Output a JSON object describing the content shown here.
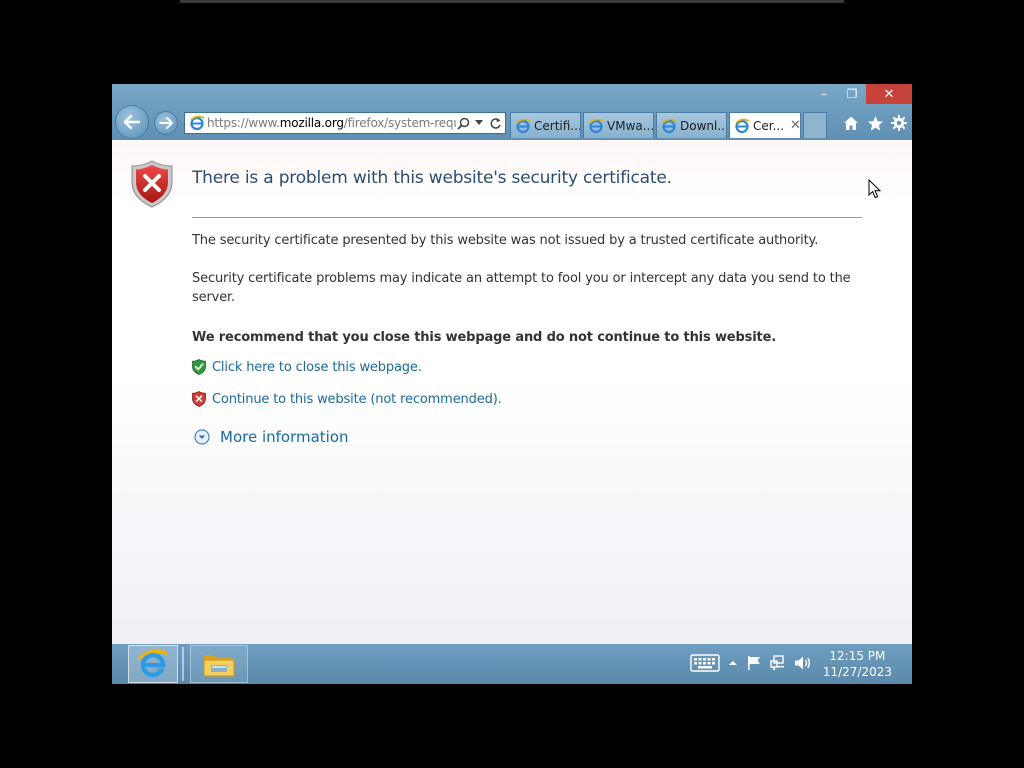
{
  "browser": {
    "address": {
      "prefix": "https://www.",
      "domain": "mozilla.org",
      "path": "/firefox/system-requi"
    },
    "tabs": [
      {
        "label": "Certifi..."
      },
      {
        "label": "VMwa..."
      },
      {
        "label": "Downl..."
      },
      {
        "label": "Cer...",
        "active": true
      }
    ],
    "caption": {
      "minimize": "–",
      "restore": "❐",
      "close": "✕"
    },
    "tab_close": "✕"
  },
  "page": {
    "title": "There is a problem with this website's security certificate.",
    "paragraph_1": "The security certificate presented by this website was not issued by a trusted certificate authority.",
    "paragraph_2": "Security certificate problems may indicate an attempt to fool you or intercept any data you send to the server.",
    "recommendation": "We recommend that you close this webpage and do not continue to this website.",
    "close_link": "Click here to close this webpage.",
    "continue_link": "Continue to this website (not recommended).",
    "more_info": "More information"
  },
  "taskbar": {
    "time": "12:15 PM",
    "date": "11/27/2023",
    "apps": [
      "internet-explorer",
      "file-explorer"
    ]
  },
  "colors": {
    "chrome": "#6f9cc0",
    "title": "#2a4d73",
    "link": "#1b6a9e",
    "close_button": "#c7423b"
  }
}
